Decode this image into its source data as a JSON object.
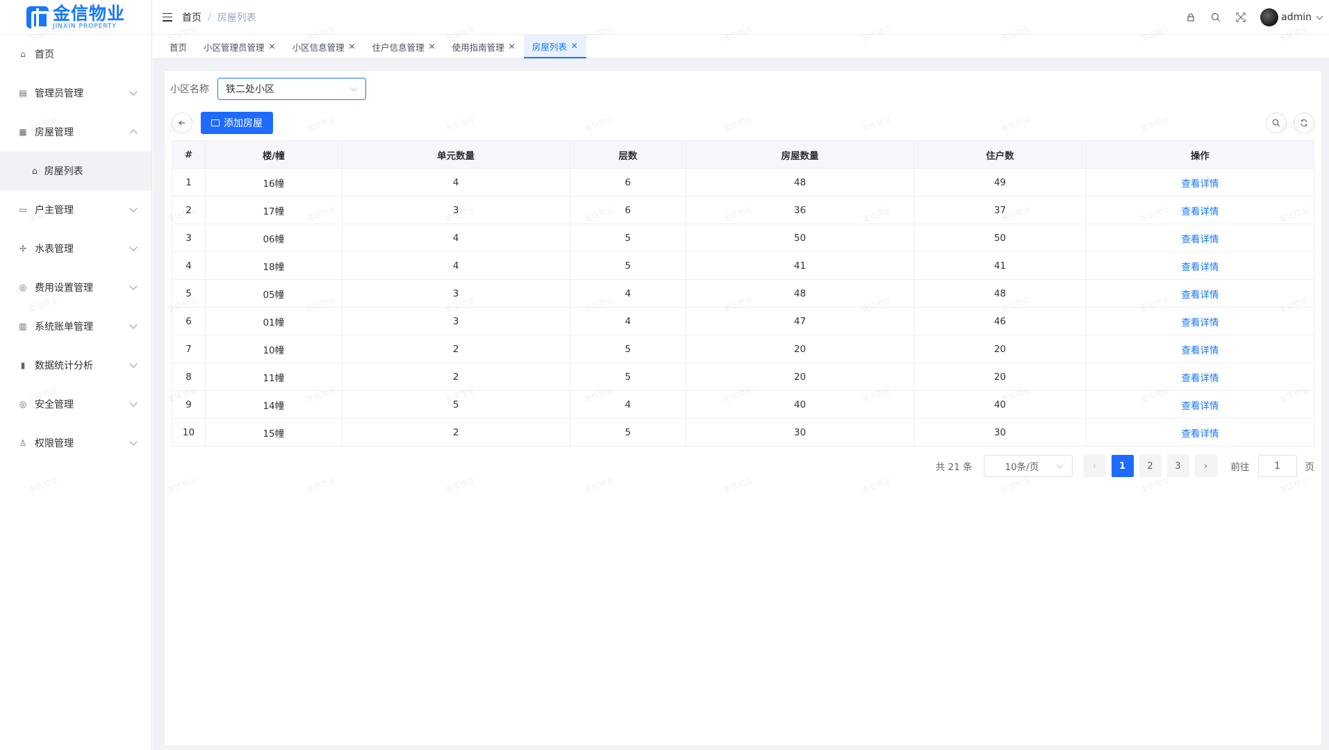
{
  "brand": {
    "name_cn": "金信物业",
    "name_en": "JINXIN PROPERTY"
  },
  "header": {
    "breadcrumb": [
      "首页",
      "房屋列表"
    ],
    "breadcrumb_sep": "/",
    "user": "admin"
  },
  "sidebar": {
    "items": [
      {
        "label": "首页",
        "icon": "home-icon"
      },
      {
        "label": "管理员管理",
        "icon": "document-icon"
      },
      {
        "label": "房屋管理",
        "icon": "grid-icon"
      },
      {
        "label": "户主管理",
        "icon": "monitor-icon"
      },
      {
        "label": "水表管理",
        "icon": "water-icon"
      },
      {
        "label": "费用设置管理",
        "icon": "settings-icon"
      },
      {
        "label": "系统账单管理",
        "icon": "book-icon"
      },
      {
        "label": "数据统计分析",
        "icon": "chart-icon"
      },
      {
        "label": "安全管理",
        "icon": "shield-icon"
      },
      {
        "label": "权限管理",
        "icon": "user-icon"
      }
    ],
    "submenu": {
      "label": "房屋列表",
      "icon": "house-icon"
    }
  },
  "tabs": [
    {
      "label": "首页",
      "closable": false
    },
    {
      "label": "小区管理员管理",
      "closable": true
    },
    {
      "label": "小区信息管理",
      "closable": true
    },
    {
      "label": "住户信息管理",
      "closable": true
    },
    {
      "label": "使用指南管理",
      "closable": true
    },
    {
      "label": "房屋列表",
      "closable": true,
      "active": true
    }
  ],
  "filter": {
    "label": "小区名称",
    "value": "铁二处小区"
  },
  "toolbar": {
    "add_label": "添加房屋"
  },
  "table": {
    "columns": [
      "#",
      "楼/幢",
      "单元数量",
      "层数",
      "房屋数量",
      "住户数",
      "操作"
    ],
    "action_label": "查看详情",
    "rows": [
      [
        "1",
        "16幢",
        "4",
        "6",
        "48",
        "49"
      ],
      [
        "2",
        "17幢",
        "3",
        "6",
        "36",
        "37"
      ],
      [
        "3",
        "06幢",
        "4",
        "5",
        "50",
        "50"
      ],
      [
        "4",
        "18幢",
        "4",
        "5",
        "41",
        "41"
      ],
      [
        "5",
        "05幢",
        "3",
        "4",
        "48",
        "48"
      ],
      [
        "6",
        "01幢",
        "3",
        "4",
        "47",
        "46"
      ],
      [
        "7",
        "10幢",
        "2",
        "5",
        "20",
        "20"
      ],
      [
        "8",
        "11幢",
        "2",
        "5",
        "20",
        "20"
      ],
      [
        "9",
        "14幢",
        "5",
        "4",
        "40",
        "40"
      ],
      [
        "10",
        "15幢",
        "2",
        "5",
        "30",
        "30"
      ]
    ]
  },
  "pagination": {
    "total": "共 21 条",
    "page_size": "10条/页",
    "pages": [
      "1",
      "2",
      "3"
    ],
    "current": "1",
    "goto_label": "前往",
    "goto_value": "1",
    "page_suffix": "页"
  },
  "watermark": "金信物业",
  "colors": {
    "primary": "#1e6bff",
    "link": "#1677ff",
    "bg": "#f0f2f5"
  }
}
